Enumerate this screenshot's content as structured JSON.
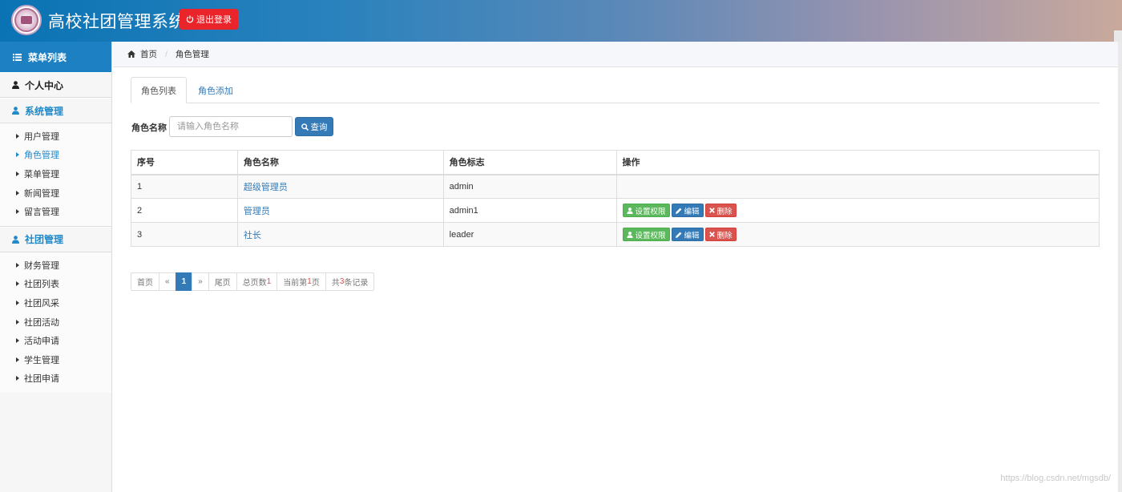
{
  "header": {
    "title": "高校社团管理系统",
    "logout_label": "退出登录"
  },
  "sidebar": {
    "heading": "菜单列表",
    "personal_center": "个人中心",
    "sections": [
      {
        "label": "系统管理",
        "items": [
          "用户管理",
          "角色管理",
          "菜单管理",
          "新闻管理",
          "留言管理"
        ]
      },
      {
        "label": "社团管理",
        "items": [
          "财务管理",
          "社团列表",
          "社团风采",
          "社团活动",
          "活动申请",
          "学生管理",
          "社团申请"
        ]
      }
    ],
    "active_item": "角色管理"
  },
  "breadcrumb": {
    "home": "首页",
    "current": "角色管理"
  },
  "tabs": [
    "角色列表",
    "角色添加"
  ],
  "search": {
    "label": "角色名称",
    "placeholder": "请输入角色名称",
    "button": "查询"
  },
  "table": {
    "headers": [
      "序号",
      "角色名称",
      "角色标志",
      "操作"
    ],
    "rows": [
      {
        "index": "1",
        "name": "超级管理员",
        "flag": "admin",
        "has_actions": false
      },
      {
        "index": "2",
        "name": "管理员",
        "flag": "admin1",
        "has_actions": true
      },
      {
        "index": "3",
        "name": "社长",
        "flag": "leader",
        "has_actions": true
      }
    ],
    "actions": {
      "permission": "设置权限",
      "edit": "编辑",
      "delete": "删除"
    }
  },
  "pagination": {
    "first": "首页",
    "prev": "«",
    "current": "1",
    "next": "»",
    "last": "尾页",
    "total_pages_label": "总页数",
    "total_pages": "1",
    "current_page_prefix": "当前第",
    "current_page": "1",
    "current_page_suffix": "页",
    "total_records_prefix": "共",
    "total_records": "3",
    "total_records_suffix": "条记录"
  },
  "watermark": "https://blog.csdn.net/mgsdb/",
  "colors": {
    "primary": "#337ab7",
    "sidebar_head": "#1c80c2",
    "danger": "#d9534f",
    "success": "#5cb85c",
    "logout": "#e9252b"
  }
}
